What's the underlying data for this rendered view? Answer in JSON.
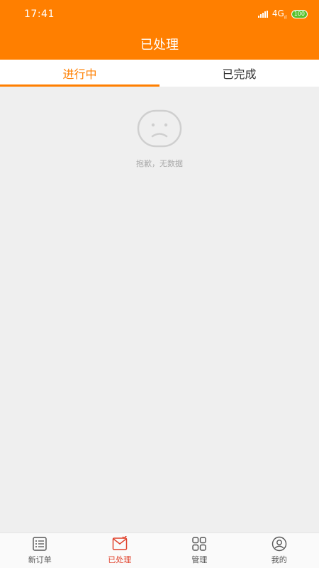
{
  "status_bar": {
    "time": "17:41",
    "network": "4G",
    "network_sub": "ıl",
    "battery": "100"
  },
  "header": {
    "title": "已处理"
  },
  "tabs": [
    {
      "label": "进行中",
      "active": true
    },
    {
      "label": "已完成",
      "active": false
    }
  ],
  "empty_state": {
    "icon": "sad-face-icon",
    "message": "抱歉，无数据"
  },
  "bottom_nav": [
    {
      "label": "新订单",
      "icon": "list-icon",
      "active": false
    },
    {
      "label": "已处理",
      "icon": "mail-check-icon",
      "active": true
    },
    {
      "label": "管理",
      "icon": "grid-icon",
      "active": false
    },
    {
      "label": "我的",
      "icon": "user-icon",
      "active": false
    }
  ],
  "colors": {
    "brand": "#ff7f00",
    "active_nav": "#e0412b",
    "battery": "#57c22c"
  }
}
